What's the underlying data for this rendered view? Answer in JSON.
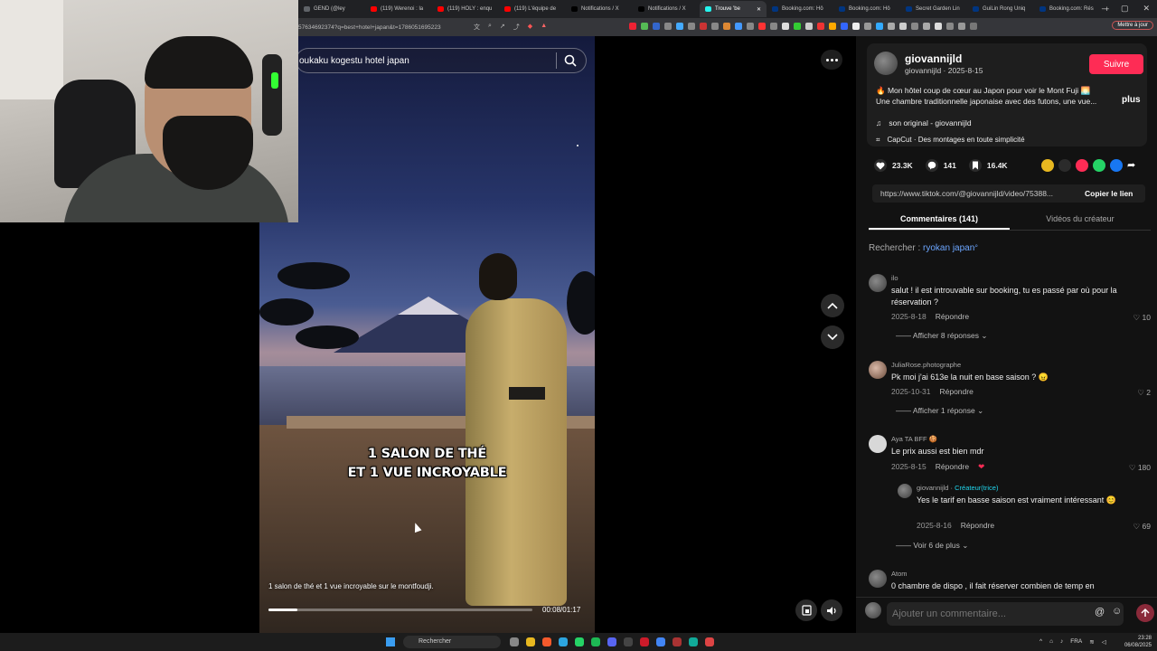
{
  "browser": {
    "tabs": [
      {
        "label": "GEND (@ley",
        "color": "#5f6368"
      },
      {
        "label": "(119) Werenoi : la",
        "color": "#ff0000"
      },
      {
        "label": "(119) HOLY : enqu",
        "color": "#ff0000"
      },
      {
        "label": "(119) L'équipe de",
        "color": "#ff0000"
      },
      {
        "label": "Notifications / X",
        "color": "#000000"
      },
      {
        "label": "Notifications / X",
        "color": "#000000"
      },
      {
        "label": "Trouve 'be",
        "color": "#25f4ee",
        "active": true
      },
      {
        "label": "Booking.com: Hô",
        "color": "#003580"
      },
      {
        "label": "Booking.com: Hô",
        "color": "#003580"
      },
      {
        "label": "Secret Garden Lin",
        "color": "#003580"
      },
      {
        "label": "GuiLin Rong Uniq",
        "color": "#003580"
      },
      {
        "label": "Booking.com: Rés",
        "color": "#003580"
      }
    ],
    "new_tab": "+",
    "url": "57634692374?q=best+hotel+japan&t=1786051695223",
    "update_label": "Mettre à jour"
  },
  "video": {
    "search_value": "oukaku kogestu hotel japan",
    "caption_line1": "1 SALON DE THÉ",
    "caption_line2": "ET 1 VUE INCROYABLE",
    "subtitle": "1 salon de thé et 1 vue incroyable sur le montfoudji.",
    "time": "00:08/01:17",
    "progress": 0.11
  },
  "creator": {
    "name": "giovannijld",
    "handle_date": "giovannijld · 2025-8-15",
    "follow_label": "Suivre",
    "desc_line1": "🔥 Mon hôtel coup de cœur au Japon pour voir le Mont Fuji 🌅",
    "desc_line2": "Une chambre traditionnelle japonaise avec des futons, une vue...",
    "more_label": "plus",
    "music": "son original - giovannijld",
    "capcut": "CapCut · Des montages en toute simplicité"
  },
  "stats": {
    "likes": "23.3K",
    "comments": "141",
    "saves": "16.4K"
  },
  "link": {
    "url": "https://www.tiktok.com/@giovannijld/video/75388...",
    "copy_label": "Copier le lien"
  },
  "tabs": {
    "comments": "Commentaires (141)",
    "creator_videos": "Vidéos du créateur"
  },
  "search_rec": {
    "prefix": "Rechercher : ",
    "term": "ryokan japan"
  },
  "comments": [
    {
      "user": "ilo",
      "text": "salut ! il est introuvable sur booking, tu es passé par où pour la réservation ?",
      "date": "2025-8-18",
      "reply": "Répondre",
      "likes": "10",
      "replies": "Afficher 8 réponses"
    },
    {
      "user": "JuliaRose.photographe",
      "text": "Pk moi j'ai 613e la nuit en base saison ? 😠",
      "date": "2025-10-31",
      "reply": "Répondre",
      "likes": "2",
      "replies": "Afficher 1 réponse"
    },
    {
      "user": "Aya TA BFF 🍪",
      "text": "Le prix aussi est bien mdr",
      "date": "2025-8-15",
      "reply": "Répondre",
      "likes": "180"
    },
    {
      "user": "giovannijld",
      "creator_tag": "Créateur(trice)",
      "text": "Yes le tarif en basse saison est vraiment intéressant 😊",
      "date": "2025-8-16",
      "reply": "Répondre",
      "likes": "69",
      "replies": "Voir 6 de plus"
    },
    {
      "user": "Atom",
      "text": "0 chambre de dispo , il fait réserver combien de temp en"
    }
  ],
  "comment_input": {
    "placeholder": "Ajouter un commentaire..."
  },
  "taskbar": {
    "search_label": "Rechercher",
    "lang": "FRA",
    "time": "23:28",
    "date": "06/08/2025"
  },
  "colors": {
    "accent": "#fe2c55",
    "link": "#6ca6ff",
    "creator": "#20d5ec"
  }
}
